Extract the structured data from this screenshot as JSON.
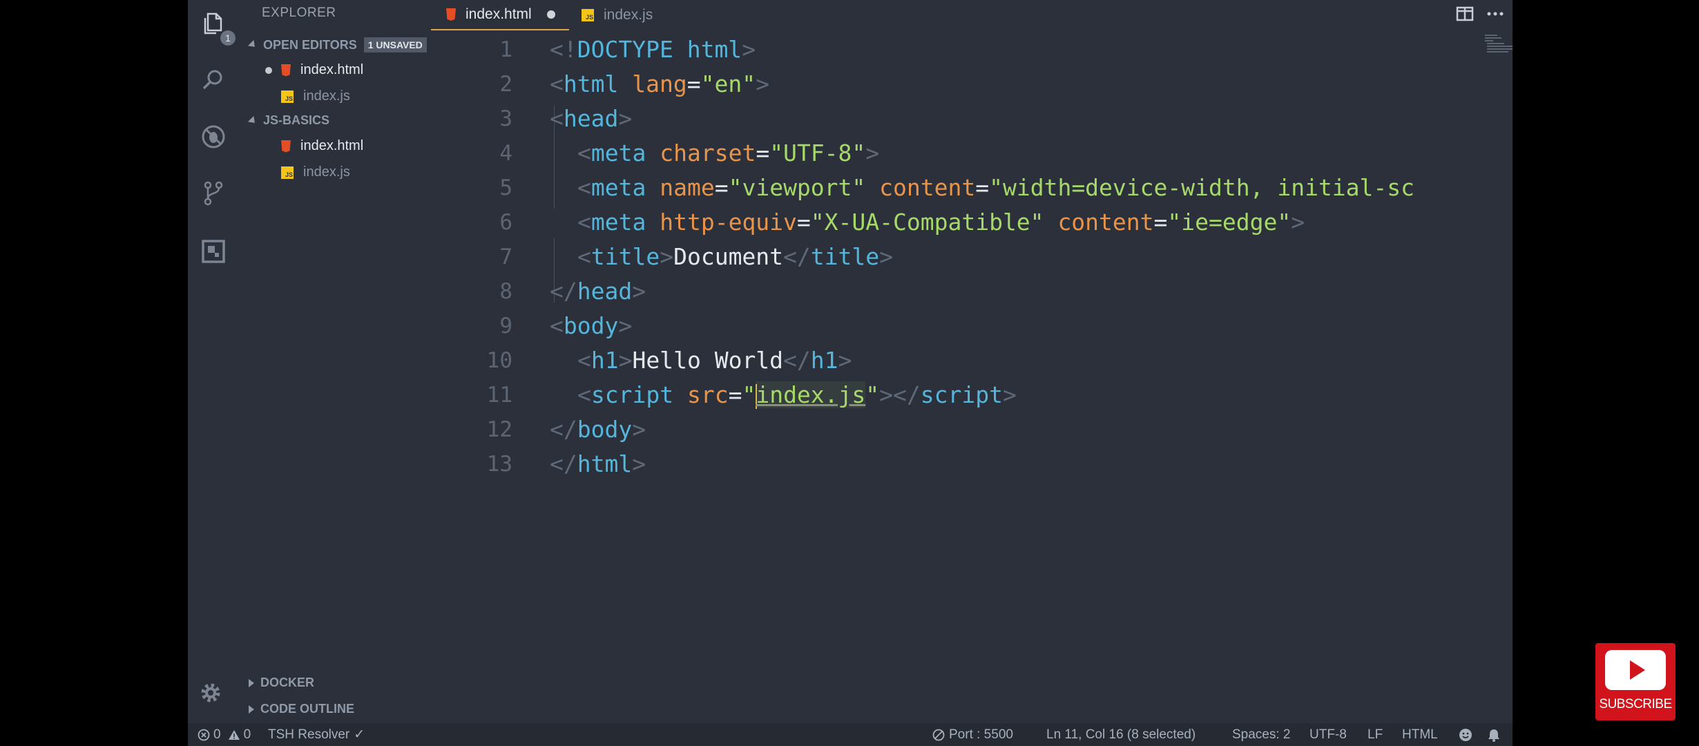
{
  "activity_bar": {
    "explorer_badge": "1"
  },
  "sidebar": {
    "title": "EXPLORER",
    "open_editors": {
      "label": "OPEN EDITORS",
      "unsaved_badge": "1 UNSAVED",
      "files": [
        {
          "name": "index.html",
          "type": "html",
          "modified": true
        },
        {
          "name": "index.js",
          "type": "js",
          "modified": false
        }
      ]
    },
    "project": {
      "label": "JS-BASICS",
      "files": [
        {
          "name": "index.html",
          "type": "html"
        },
        {
          "name": "index.js",
          "type": "js"
        }
      ]
    },
    "docker_label": "DOCKER",
    "outline_label": "CODE OUTLINE"
  },
  "tabs": [
    {
      "label": "index.html",
      "type": "html",
      "active": true,
      "modified": true
    },
    {
      "label": "index.js",
      "type": "js",
      "active": false,
      "modified": false
    }
  ],
  "editor": {
    "lines": [
      {
        "n": "1"
      },
      {
        "n": "2"
      },
      {
        "n": "3"
      },
      {
        "n": "4"
      },
      {
        "n": "5"
      },
      {
        "n": "6"
      },
      {
        "n": "7"
      },
      {
        "n": "8"
      },
      {
        "n": "9"
      },
      {
        "n": "10"
      },
      {
        "n": "11"
      },
      {
        "n": "12"
      },
      {
        "n": "13"
      }
    ],
    "code": {
      "l1": [
        "<!",
        "DOCTYPE",
        " ",
        "html",
        ">"
      ],
      "l2": [
        "<",
        "html",
        " ",
        "lang",
        "=",
        "\"en\"",
        ">"
      ],
      "l3": [
        "<",
        "head",
        ">"
      ],
      "l4": [
        "<",
        "meta",
        " ",
        "charset",
        "=",
        "\"UTF-8\"",
        ">"
      ],
      "l5": [
        "<",
        "meta",
        " ",
        "name",
        "=",
        "\"viewport\"",
        " ",
        "content",
        "=",
        "\"width=device-width, initial-sc"
      ],
      "l6": [
        "<",
        "meta",
        " ",
        "http-equiv",
        "=",
        "\"X-UA-Compatible\"",
        " ",
        "content",
        "=",
        "\"ie=edge\"",
        ">"
      ],
      "l7": [
        "<",
        "title",
        ">",
        "Document",
        "</",
        "title",
        ">"
      ],
      "l8": [
        "</",
        "head",
        ">"
      ],
      "l9": [
        "<",
        "body",
        ">"
      ],
      "l10": [
        "<",
        "h1",
        ">",
        "Hello World",
        "</",
        "h1",
        ">"
      ],
      "l11": [
        "<",
        "script",
        " ",
        "src",
        "=",
        "\"",
        "index.js",
        "\"",
        "></",
        "script",
        ">"
      ],
      "l12": [
        "</",
        "body",
        ">"
      ],
      "l13": [
        "</",
        "html",
        ">"
      ]
    }
  },
  "status_bar": {
    "errors": "0",
    "warnings": "0",
    "resolver": "TSH Resolver",
    "port": "Port : 5500",
    "position": "Ln 11, Col 16 (8 selected)",
    "spaces": "Spaces: 2",
    "encoding": "UTF-8",
    "eol": "LF",
    "language": "HTML"
  },
  "overlay": {
    "subscribe_label": "SUBSCRIBE"
  },
  "colors": {
    "background": "#2b303b",
    "tag": "#55b5db",
    "attribute": "#e8944a",
    "string": "#a6d96a",
    "accent": "#e2a350",
    "subscribe": "#d1141b"
  }
}
